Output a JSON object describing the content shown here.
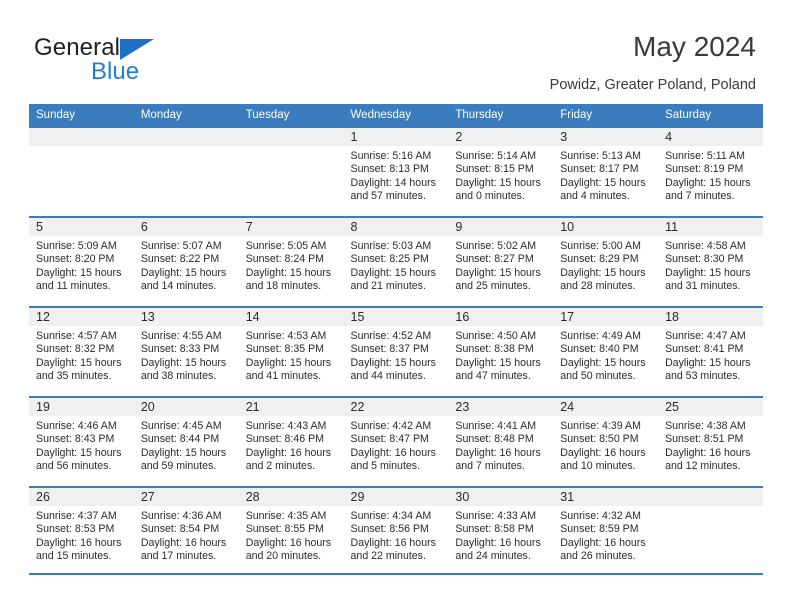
{
  "brand": {
    "name_part1": "General",
    "name_part2": "Blue",
    "triangle_color": "#1f6fc4",
    "blue_color": "#1f7fd4"
  },
  "header": {
    "title": "May 2024",
    "subtitle": "Powidz, Greater Poland, Poland",
    "accent_color": "#3a7cbe"
  },
  "weekdays": [
    "Sunday",
    "Monday",
    "Tuesday",
    "Wednesday",
    "Thursday",
    "Friday",
    "Saturday"
  ],
  "labels": {
    "sunrise": "Sunrise:",
    "sunset": "Sunset:",
    "daylight": "Daylight:"
  },
  "weeks": [
    [
      {
        "day": "",
        "blank": true
      },
      {
        "day": "",
        "blank": true
      },
      {
        "day": "",
        "blank": true
      },
      {
        "day": "1",
        "sunrise": "Sunrise: 5:16 AM",
        "sunset": "Sunset: 8:13 PM",
        "daylight1": "Daylight: 14 hours",
        "daylight2": "and 57 minutes."
      },
      {
        "day": "2",
        "sunrise": "Sunrise: 5:14 AM",
        "sunset": "Sunset: 8:15 PM",
        "daylight1": "Daylight: 15 hours",
        "daylight2": "and 0 minutes."
      },
      {
        "day": "3",
        "sunrise": "Sunrise: 5:13 AM",
        "sunset": "Sunset: 8:17 PM",
        "daylight1": "Daylight: 15 hours",
        "daylight2": "and 4 minutes."
      },
      {
        "day": "4",
        "sunrise": "Sunrise: 5:11 AM",
        "sunset": "Sunset: 8:19 PM",
        "daylight1": "Daylight: 15 hours",
        "daylight2": "and 7 minutes."
      }
    ],
    [
      {
        "day": "5",
        "sunrise": "Sunrise: 5:09 AM",
        "sunset": "Sunset: 8:20 PM",
        "daylight1": "Daylight: 15 hours",
        "daylight2": "and 11 minutes."
      },
      {
        "day": "6",
        "sunrise": "Sunrise: 5:07 AM",
        "sunset": "Sunset: 8:22 PM",
        "daylight1": "Daylight: 15 hours",
        "daylight2": "and 14 minutes."
      },
      {
        "day": "7",
        "sunrise": "Sunrise: 5:05 AM",
        "sunset": "Sunset: 8:24 PM",
        "daylight1": "Daylight: 15 hours",
        "daylight2": "and 18 minutes."
      },
      {
        "day": "8",
        "sunrise": "Sunrise: 5:03 AM",
        "sunset": "Sunset: 8:25 PM",
        "daylight1": "Daylight: 15 hours",
        "daylight2": "and 21 minutes."
      },
      {
        "day": "9",
        "sunrise": "Sunrise: 5:02 AM",
        "sunset": "Sunset: 8:27 PM",
        "daylight1": "Daylight: 15 hours",
        "daylight2": "and 25 minutes."
      },
      {
        "day": "10",
        "sunrise": "Sunrise: 5:00 AM",
        "sunset": "Sunset: 8:29 PM",
        "daylight1": "Daylight: 15 hours",
        "daylight2": "and 28 minutes."
      },
      {
        "day": "11",
        "sunrise": "Sunrise: 4:58 AM",
        "sunset": "Sunset: 8:30 PM",
        "daylight1": "Daylight: 15 hours",
        "daylight2": "and 31 minutes."
      }
    ],
    [
      {
        "day": "12",
        "sunrise": "Sunrise: 4:57 AM",
        "sunset": "Sunset: 8:32 PM",
        "daylight1": "Daylight: 15 hours",
        "daylight2": "and 35 minutes."
      },
      {
        "day": "13",
        "sunrise": "Sunrise: 4:55 AM",
        "sunset": "Sunset: 8:33 PM",
        "daylight1": "Daylight: 15 hours",
        "daylight2": "and 38 minutes."
      },
      {
        "day": "14",
        "sunrise": "Sunrise: 4:53 AM",
        "sunset": "Sunset: 8:35 PM",
        "daylight1": "Daylight: 15 hours",
        "daylight2": "and 41 minutes."
      },
      {
        "day": "15",
        "sunrise": "Sunrise: 4:52 AM",
        "sunset": "Sunset: 8:37 PM",
        "daylight1": "Daylight: 15 hours",
        "daylight2": "and 44 minutes."
      },
      {
        "day": "16",
        "sunrise": "Sunrise: 4:50 AM",
        "sunset": "Sunset: 8:38 PM",
        "daylight1": "Daylight: 15 hours",
        "daylight2": "and 47 minutes."
      },
      {
        "day": "17",
        "sunrise": "Sunrise: 4:49 AM",
        "sunset": "Sunset: 8:40 PM",
        "daylight1": "Daylight: 15 hours",
        "daylight2": "and 50 minutes."
      },
      {
        "day": "18",
        "sunrise": "Sunrise: 4:47 AM",
        "sunset": "Sunset: 8:41 PM",
        "daylight1": "Daylight: 15 hours",
        "daylight2": "and 53 minutes."
      }
    ],
    [
      {
        "day": "19",
        "sunrise": "Sunrise: 4:46 AM",
        "sunset": "Sunset: 8:43 PM",
        "daylight1": "Daylight: 15 hours",
        "daylight2": "and 56 minutes."
      },
      {
        "day": "20",
        "sunrise": "Sunrise: 4:45 AM",
        "sunset": "Sunset: 8:44 PM",
        "daylight1": "Daylight: 15 hours",
        "daylight2": "and 59 minutes."
      },
      {
        "day": "21",
        "sunrise": "Sunrise: 4:43 AM",
        "sunset": "Sunset: 8:46 PM",
        "daylight1": "Daylight: 16 hours",
        "daylight2": "and 2 minutes."
      },
      {
        "day": "22",
        "sunrise": "Sunrise: 4:42 AM",
        "sunset": "Sunset: 8:47 PM",
        "daylight1": "Daylight: 16 hours",
        "daylight2": "and 5 minutes."
      },
      {
        "day": "23",
        "sunrise": "Sunrise: 4:41 AM",
        "sunset": "Sunset: 8:48 PM",
        "daylight1": "Daylight: 16 hours",
        "daylight2": "and 7 minutes."
      },
      {
        "day": "24",
        "sunrise": "Sunrise: 4:39 AM",
        "sunset": "Sunset: 8:50 PM",
        "daylight1": "Daylight: 16 hours",
        "daylight2": "and 10 minutes."
      },
      {
        "day": "25",
        "sunrise": "Sunrise: 4:38 AM",
        "sunset": "Sunset: 8:51 PM",
        "daylight1": "Daylight: 16 hours",
        "daylight2": "and 12 minutes."
      }
    ],
    [
      {
        "day": "26",
        "sunrise": "Sunrise: 4:37 AM",
        "sunset": "Sunset: 8:53 PM",
        "daylight1": "Daylight: 16 hours",
        "daylight2": "and 15 minutes."
      },
      {
        "day": "27",
        "sunrise": "Sunrise: 4:36 AM",
        "sunset": "Sunset: 8:54 PM",
        "daylight1": "Daylight: 16 hours",
        "daylight2": "and 17 minutes."
      },
      {
        "day": "28",
        "sunrise": "Sunrise: 4:35 AM",
        "sunset": "Sunset: 8:55 PM",
        "daylight1": "Daylight: 16 hours",
        "daylight2": "and 20 minutes."
      },
      {
        "day": "29",
        "sunrise": "Sunrise: 4:34 AM",
        "sunset": "Sunset: 8:56 PM",
        "daylight1": "Daylight: 16 hours",
        "daylight2": "and 22 minutes."
      },
      {
        "day": "30",
        "sunrise": "Sunrise: 4:33 AM",
        "sunset": "Sunset: 8:58 PM",
        "daylight1": "Daylight: 16 hours",
        "daylight2": "and 24 minutes."
      },
      {
        "day": "31",
        "sunrise": "Sunrise: 4:32 AM",
        "sunset": "Sunset: 8:59 PM",
        "daylight1": "Daylight: 16 hours",
        "daylight2": "and 26 minutes."
      },
      {
        "day": "",
        "blank": true
      }
    ]
  ]
}
